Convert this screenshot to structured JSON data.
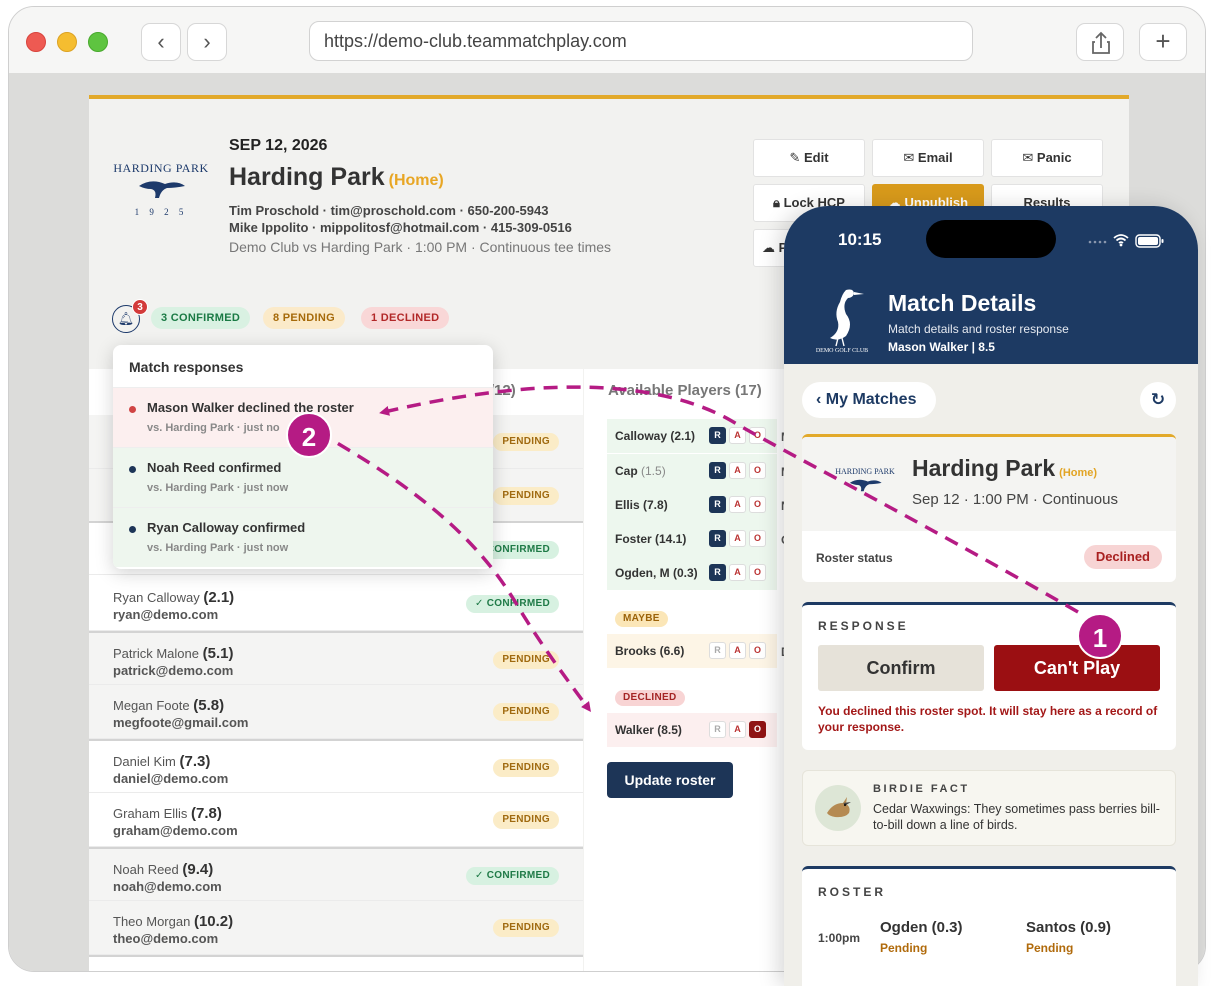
{
  "browser": {
    "url": "https://demo-club.teammatchplay.com"
  },
  "match": {
    "date": "SEP 12, 2026",
    "venue": "Harding Park",
    "home_tag": "(Home)",
    "contact1": "Tim Proschold · tim@proschold.com · 650-200-5943",
    "contact2": "Mike Ippolito · mippolitosf@hotmail.com · 415-309-0516",
    "subtitle": "Demo Club vs Harding Park · 1:00 PM · Continuous tee times",
    "logo_text": "HARDING PARK",
    "logo_year": "1 9 2 5"
  },
  "actions": {
    "edit": "Edit",
    "email": "Email",
    "panic": "Panic",
    "lock": "Lock HCP",
    "unpublish": "Unpublish",
    "results": "Results",
    "push": "Pus"
  },
  "summary": {
    "bell_count": "3",
    "confirmed": "3 CONFIRMED",
    "pending": "8 PENDING",
    "declined": "1 DECLINED"
  },
  "roster_header": "r (11/12)",
  "roster": [
    {
      "name": "Ryan Calloway",
      "hcp": "(2.1)",
      "email": "ryan@demo.com",
      "status": "✓ CONFIRMED"
    },
    {
      "name": "Patrick Malone",
      "hcp": "(5.1)",
      "email": "patrick@demo.com",
      "status": "PENDING"
    },
    {
      "name": "Megan Foote",
      "hcp": "(5.8)",
      "email": "megfoote@gmail.com",
      "status": "PENDING"
    },
    {
      "name": "Daniel Kim",
      "hcp": "(7.3)",
      "email": "daniel@demo.com",
      "status": "PENDING"
    },
    {
      "name": "Graham Ellis",
      "hcp": "(7.8)",
      "email": "graham@demo.com",
      "status": "PENDING"
    },
    {
      "name": "Noah Reed",
      "hcp": "(9.4)",
      "email": "noah@demo.com",
      "status": "✓ CONFIRMED"
    },
    {
      "name": "Theo Morgan",
      "hcp": "(10.2)",
      "email": "theo@demo.com",
      "status": "PENDING"
    }
  ],
  "hidden_rows": {
    "row1_status": "PENDING",
    "row2_status": "PENDING",
    "row3_status": "CONFIRMED"
  },
  "available": {
    "header": "Available Players (17)",
    "players": [
      {
        "name": "Calloway (2.1)",
        "cut": "Ma"
      },
      {
        "name": "Cap",
        "hcp": "(1.5)",
        "cut": "Mo"
      },
      {
        "name": "Ellis (7.8)",
        "cut": "Ng"
      },
      {
        "name": "Foster (14.1)",
        "cut": "Og"
      },
      {
        "name": "Ogden, M (0.3)",
        "cut": ""
      }
    ],
    "maybe_tag": "MAYBE",
    "maybe_player": "Brooks (6.6)",
    "maybe_cut": "Du",
    "declined_tag": "DECLINED",
    "declined_player": "Walker (8.5)",
    "r": "R",
    "a": "A",
    "o": "O",
    "update_button": "Update roster"
  },
  "popover": {
    "title": "Match responses",
    "items": [
      {
        "text": "Mason Walker declined the roster",
        "sub": "vs. Harding Park · just no"
      },
      {
        "text": "Noah Reed confirmed",
        "sub": "vs. Harding Park · just now"
      },
      {
        "text": "Ryan Calloway confirmed",
        "sub": "vs. Harding Park · just now"
      }
    ]
  },
  "phone": {
    "time": "10:15",
    "title": "Match Details",
    "subtitle": "Match details and roster response",
    "user": "Mason Walker | 8.5",
    "logo_text": "DEMO GOLF CLUB",
    "back": "My Matches",
    "match_title": "Harding Park",
    "match_home": "(Home)",
    "match_sub": "Sep 12 · 1:00 PM · Continuous",
    "roster_status_label": "Roster status",
    "roster_status_value": "Declined",
    "response_heading": "RESPONSE",
    "confirm": "Confirm",
    "cant_play": "Can't Play",
    "response_note": "You declined this roster spot. It will stay here as a record of your response.",
    "fact_heading": "BIRDIE FACT",
    "fact_text": "Cedar Waxwings: They sometimes pass berries bill-to-bill down a line of birds.",
    "roster_heading": "ROSTER",
    "tee_time": "1:00pm",
    "p1": "Ogden (0.3)",
    "p1_status": "Pending",
    "p2": "Santos (0.9)",
    "p2_status": "Pending"
  },
  "annotations": {
    "step1": "1",
    "step2": "2",
    "color": "#b51b84"
  }
}
